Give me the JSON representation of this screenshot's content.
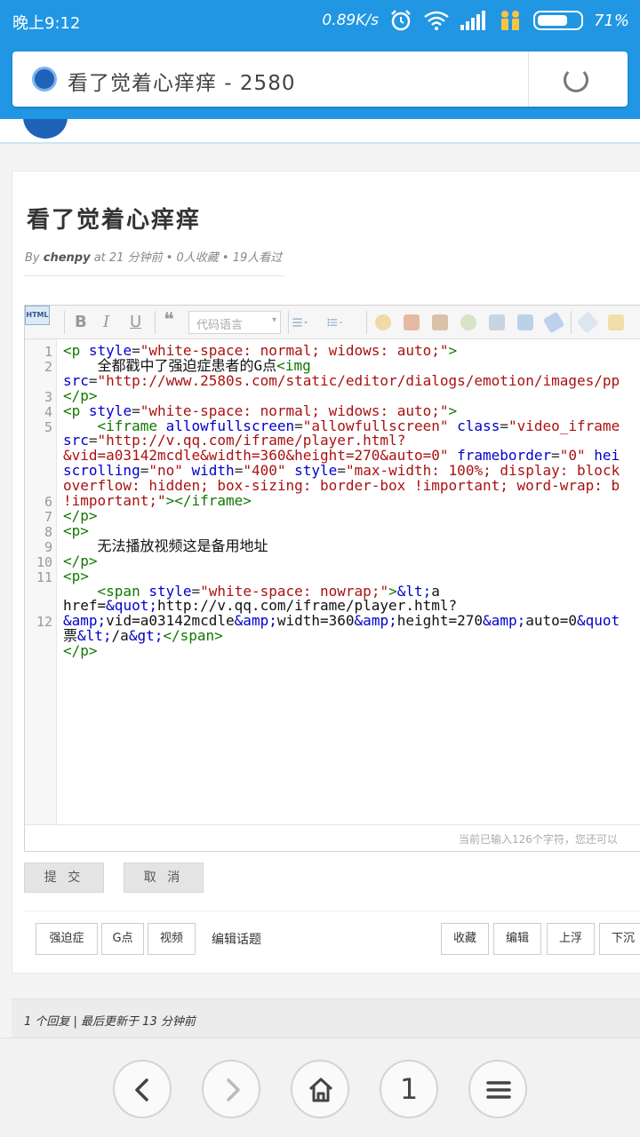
{
  "status": {
    "time": "晚上9:12",
    "speed": "0.89K/s",
    "battery": "71%",
    "battery_level": 0.71
  },
  "browser": {
    "title": "看了觉着心痒痒 - 2580"
  },
  "topic": {
    "title": "看了觉着心痒痒",
    "meta_by": "By",
    "author": "chenpy",
    "meta_rest": " at 21 分钟前 • 0人收藏 • 19人看过"
  },
  "editor": {
    "toolbar": {
      "html": "HTML",
      "bold": "B",
      "italic": "I",
      "underline": "U",
      "quote": "❝",
      "code_lang_placeholder": "代码语言"
    },
    "line_numbers": [
      "1",
      "2",
      "",
      "3",
      "4",
      "5",
      "",
      "",
      "",
      "",
      "6",
      "7",
      "8",
      "9",
      "10",
      "11",
      "",
      "",
      "12"
    ],
    "status_text": "当前已输入126个字符，您还可以"
  },
  "actions": {
    "submit": "提 交",
    "cancel": "取 消"
  },
  "tags": {
    "items": [
      "强迫症",
      "G点",
      "视频"
    ],
    "edit_topic": "编辑话题"
  },
  "topic_actions": [
    "收藏",
    "编辑",
    "上浮",
    "下沉"
  ],
  "reply_bar": "1 个回复 | 最后更新于 13 分钟前",
  "nav": {
    "tabs_count": "1"
  }
}
